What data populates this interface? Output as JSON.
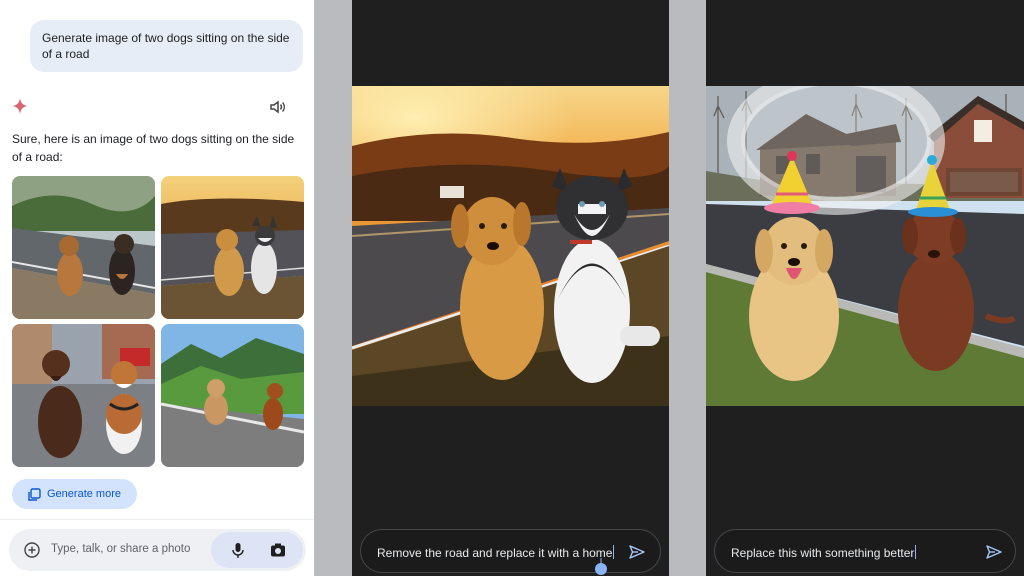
{
  "chat": {
    "user_prompt": "Generate image of two dogs sitting on the side of a road",
    "assistant_reply": "Sure, here is an image of two dogs sitting on the side of a road:",
    "generate_more_label": "Generate more",
    "input_placeholder": "Type, talk, or share a photo"
  },
  "edit_road": {
    "input_text": "Remove the road and replace it with a home"
  },
  "edit_house": {
    "input_text": "Replace this with something better"
  },
  "icons": {
    "sparkle": "gemini-sparkle-icon",
    "speaker": "speaker-icon",
    "gallery": "image-gallery-icon",
    "plus": "add-icon",
    "mic": "microphone-icon",
    "camera": "camera-icon",
    "send": "send-icon"
  },
  "colors": {
    "accent": "#0b57d0",
    "chip_bg": "#d3e3fd",
    "user_bubble": "#e7edf6",
    "dark_bg": "#1f1f1f"
  }
}
